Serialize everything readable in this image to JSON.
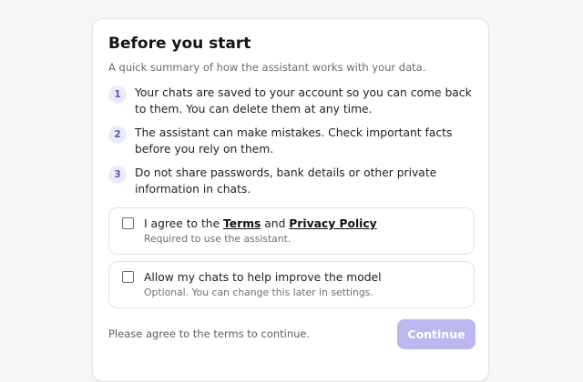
{
  "card": {
    "title": "Before you start",
    "subtitle": "A quick summary of how the assistant works with your data."
  },
  "steps": [
    {
      "number": "1",
      "text": "Your chats are saved to your account so you can come back to them. You can delete them at any time."
    },
    {
      "number": "2",
      "text": "The assistant can make mistakes. Check important facts before you rely on them."
    },
    {
      "number": "3",
      "text": "Do not share passwords, bank details or other private information in chats."
    }
  ],
  "consent": {
    "terms": {
      "checked": false,
      "label_prefix": "I agree to the ",
      "terms_link": "Terms",
      "label_middle": " and ",
      "privacy_link": "Privacy Policy",
      "hint": "Required to use the assistant."
    },
    "improve": {
      "checked": false,
      "label": "Allow my chats to help improve the model",
      "hint": "Optional. You can change this later in settings."
    }
  },
  "footer": {
    "note": "Please agree to the terms to continue.",
    "continue_label": "Continue",
    "continue_disabled": true
  },
  "colors": {
    "accent": "#6c63d9",
    "accent_disabled": "#bcb7ef",
    "badge_bg": "#ecebfb",
    "page_bg": "#f6f6f6"
  }
}
